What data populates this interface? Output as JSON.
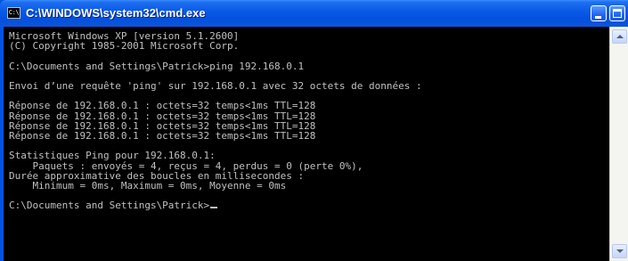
{
  "window": {
    "title": "C:\\WINDOWS\\system32\\cmd.exe",
    "icon_label": "C:\\",
    "icon": "cmd-icon"
  },
  "titlebar_buttons": {
    "minimize": "minimize-icon",
    "maximize": "maximize-icon",
    "close": "close-icon"
  },
  "colors": {
    "titlebar": "#0a5ae8",
    "console_background": "#000000",
    "console_text": "#c0c0c0"
  },
  "console": {
    "lines": [
      "Microsoft Windows XP [version 5.1.2600]",
      "(C) Copyright 1985-2001 Microsoft Corp.",
      "",
      "C:\\Documents and Settings\\Patrick>ping 192.168.0.1",
      "",
      "Envoi d’une requête 'ping' sur 192.168.0.1 avec 32 octets de données :",
      "",
      "Réponse de 192.168.0.1 : octets=32 temps<1ms TTL=128",
      "Réponse de 192.168.0.1 : octets=32 temps<1ms TTL=128",
      "Réponse de 192.168.0.1 : octets=32 temps<1ms TTL=128",
      "Réponse de 192.168.0.1 : octets=32 temps<1ms TTL=128",
      "",
      "Statistiques Ping pour 192.168.0.1:",
      "    Paquets : envoyés = 4, reçus = 4, perdus = 0 (perte 0%),",
      "Durée approximative des boucles en millisecondes :",
      "    Minimum = 0ms, Maximum = 0ms, Moyenne = 0ms",
      "",
      "C:\\Documents and Settings\\Patrick>"
    ]
  },
  "scrollbar": {
    "up": "scroll-up-arrow-icon",
    "down": "scroll-down-arrow-icon"
  }
}
